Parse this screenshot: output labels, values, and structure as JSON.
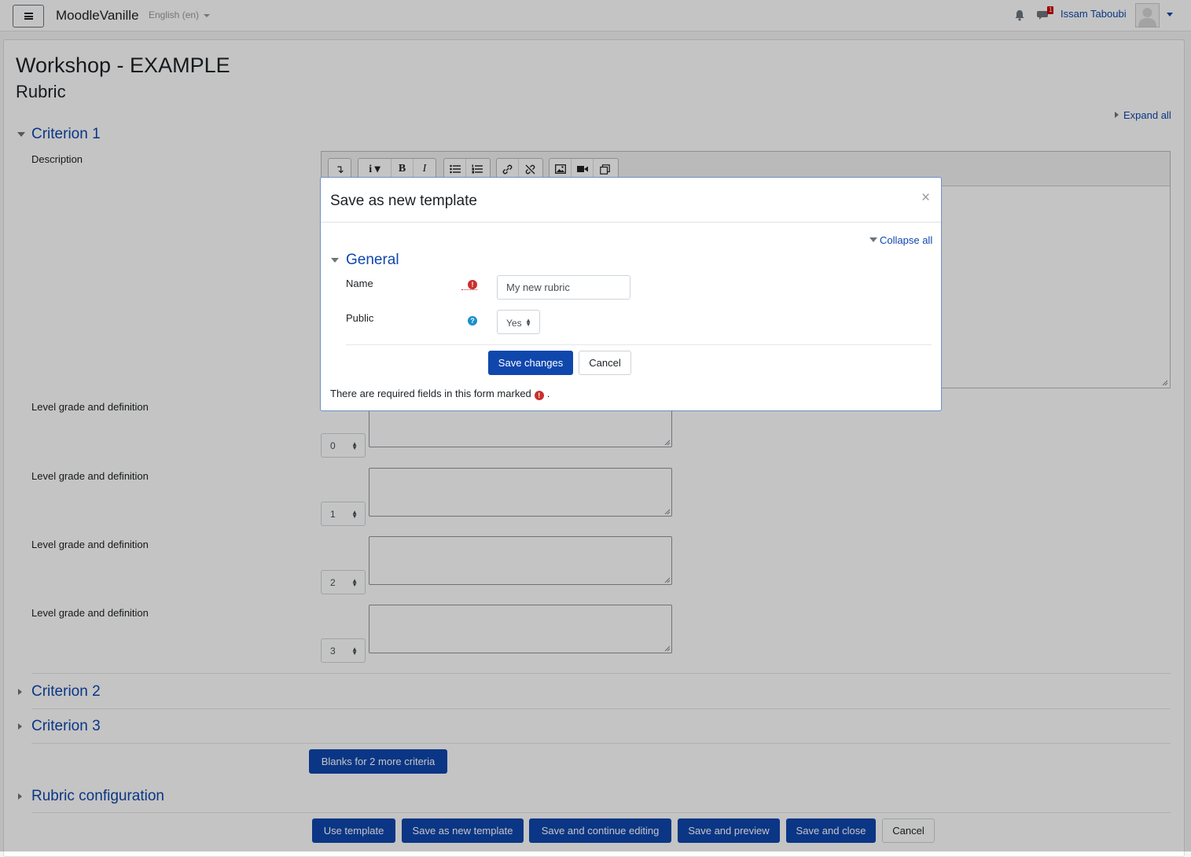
{
  "navbar": {
    "site_name": "MoodleVanille",
    "language": "English (en)",
    "message_count": "1",
    "user_name": "Issam Taboubi"
  },
  "page": {
    "title": "Workshop - EXAMPLE",
    "subtitle": "Rubric",
    "expand_all": "Expand all"
  },
  "criterion1": {
    "heading": "Criterion 1",
    "description_label": "Description",
    "levels": [
      {
        "label": "Level grade and definition",
        "grade": "0"
      },
      {
        "label": "Level grade and definition",
        "grade": "1"
      },
      {
        "label": "Level grade and definition",
        "grade": "2"
      },
      {
        "label": "Level grade and definition",
        "grade": "3"
      }
    ]
  },
  "sections": {
    "criterion2": "Criterion 2",
    "criterion3": "Criterion 3",
    "blanks_button": "Blanks for 2 more criteria",
    "rubric_config": "Rubric configuration"
  },
  "footer_buttons": {
    "use_template": "Use template",
    "save_as_new_template": "Save as new template",
    "save_continue": "Save and continue editing",
    "save_preview": "Save and preview",
    "save_close": "Save and close",
    "cancel": "Cancel"
  },
  "modal": {
    "title": "Save as new template",
    "close": "×",
    "collapse_all": "Collapse all",
    "section": "General",
    "name_label": "Name",
    "name_value": "My new rubric",
    "public_label": "Public",
    "public_value": "Yes",
    "save_changes": "Save changes",
    "cancel": "Cancel",
    "required_note": "There are required fields in this form marked",
    "required_note_end": "."
  },
  "colors": {
    "link": "#0f47ad",
    "primary_button": "#0f47ad",
    "required": "#c9302c",
    "help": "#1a8fd0"
  }
}
